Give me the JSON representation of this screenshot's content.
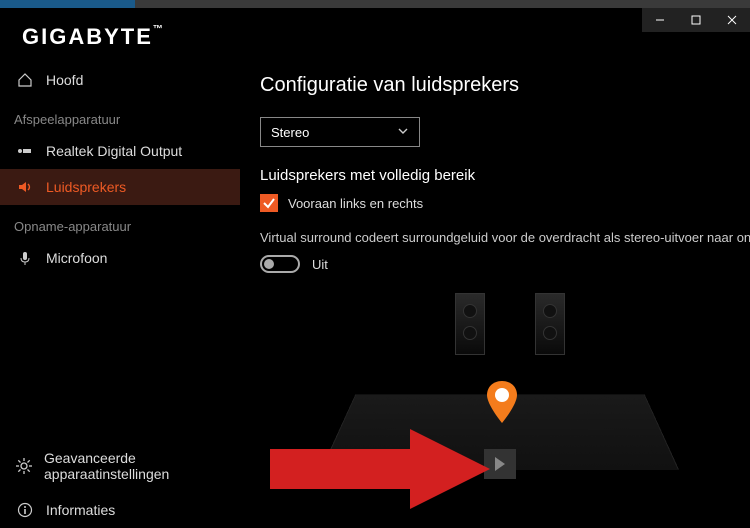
{
  "logo": "GIGABYTE",
  "sidebar": {
    "home_label": "Hoofd",
    "section_playback": "Afspeelapparatuur",
    "items_playback": [
      {
        "label": "Realtek Digital Output"
      },
      {
        "label": "Luidsprekers"
      }
    ],
    "section_record": "Opname-apparatuur",
    "items_record": [
      {
        "label": "Microfoon"
      }
    ],
    "advanced_label": "Geavanceerde apparaatinstellingen",
    "info_label": "Informaties"
  },
  "content": {
    "title": "Configuratie van luidsprekers",
    "select_value": "Stereo",
    "full_range_label": "Luidsprekers met volledig bereik",
    "front_lr_label": "Vooraan links en rechts",
    "virtual_surround_text": "Virtual surround codeert surroundgeluid voor de overdracht als stereo-uitvoer naar ontvange",
    "toggle_state": "Uit"
  }
}
